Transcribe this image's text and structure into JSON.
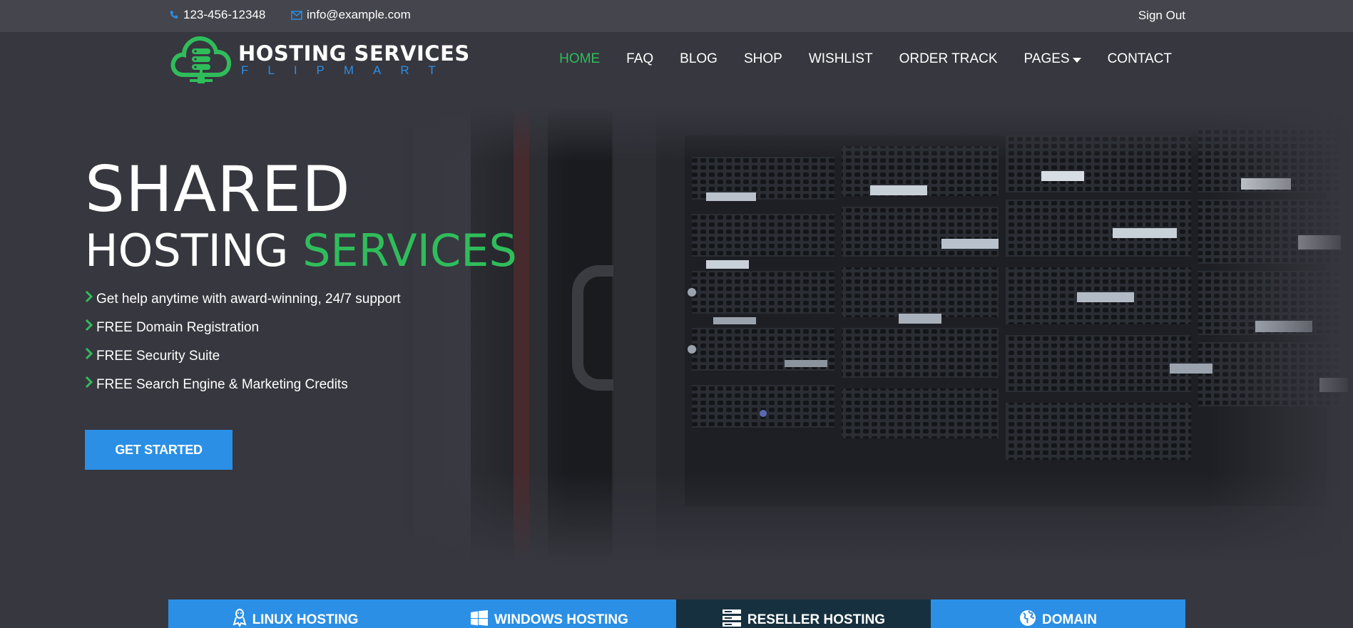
{
  "topbar": {
    "phone": "123-456-12348",
    "email": "info@example.com",
    "signout": "Sign Out",
    "phone_icon": "phone-icon",
    "email_icon": "envelope-icon"
  },
  "logo": {
    "main": "HOSTING SERVICES",
    "sub": "FLIPMART",
    "icon": "cloud-server-icon"
  },
  "nav": {
    "items": [
      {
        "label": "HOME"
      },
      {
        "label": "FAQ"
      },
      {
        "label": "BLOG"
      },
      {
        "label": "SHOP"
      },
      {
        "label": "WISHLIST"
      },
      {
        "label": "ORDER TRACK"
      },
      {
        "label": "PAGES"
      },
      {
        "label": "CONTACT"
      }
    ],
    "active": "HOME"
  },
  "hero": {
    "title_line1": "SHARED",
    "title_line2_a": "HOSTING",
    "title_line2_b": "SERVICES",
    "features": [
      "Get help anytime with award-winning, 24/7 support",
      "FREE Domain Registration",
      "FREE Security Suite",
      "FREE Search Engine & Marketing Credits"
    ],
    "cta": "GET STARTED",
    "background": "server-rack-image"
  },
  "tabs": [
    {
      "label": "LINUX HOSTING",
      "icon": "linux-icon"
    },
    {
      "label": "WINDOWS HOSTING",
      "icon": "windows-icon"
    },
    {
      "label": "RESELLER HOSTING",
      "icon": "server-icon"
    },
    {
      "label": "DOMAIN",
      "icon": "globe-icon"
    }
  ],
  "colors": {
    "accent_green": "#2fbd5b",
    "accent_blue": "#2b8fe5",
    "background": "#37373f",
    "topbar": "#45454d",
    "active_tab": "#16303f"
  }
}
